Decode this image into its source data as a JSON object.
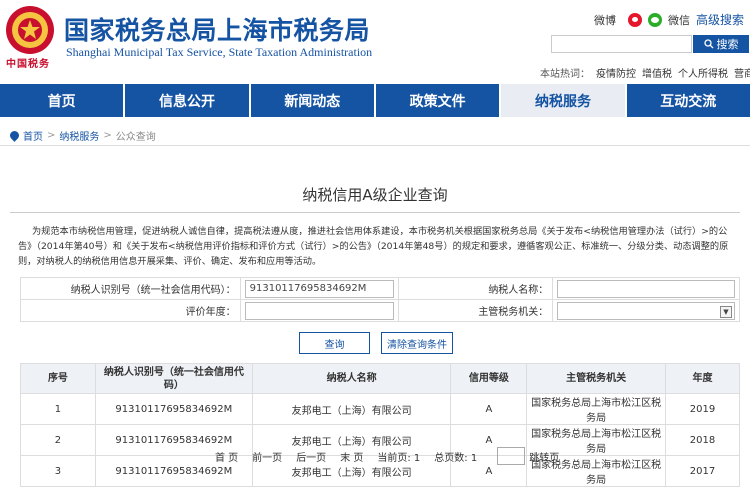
{
  "header": {
    "title": "国家税务总局上海市税务局",
    "subtitle": "Shanghai Municipal Tax Service, State Taxation Administration",
    "emblem_text": "中国税务",
    "weibo": "微博",
    "weixin": "微信",
    "advanced_search": "高级搜索",
    "search_placeholder": "",
    "search_button": "搜索",
    "hot_label": "本站热词：",
    "hot_words": [
      "疫情防控",
      "增值税",
      "个人所得税",
      "营商环境"
    ]
  },
  "nav": [
    "首页",
    "信息公开",
    "新闻动态",
    "政策文件",
    "纳税服务",
    "互动交流"
  ],
  "breadcrumb": [
    "首页",
    "纳税服务",
    "公众查询"
  ],
  "page": {
    "title": "纳税信用A级企业查询",
    "intro": "为规范本市纳税信用管理，促进纳税人诚信自律，提高税法遵从度，推进社会信用体系建设，本市税务机关根据国家税务总局《关于发布<纳税信用管理办法（试行）>的公告》（2014年第40号）和《关于发布<纳税信用评价指标和评价方式（试行）>的公告》（2014年第48号）的规定和要求，遵循客观公正、标准统一、分级分类、动态调整的原则，对纳税人的纳税信用信息开展采集、评价、确定、发布和应用等活动。"
  },
  "form": {
    "taxpayer_id_label": "纳税人识别号（统一社会信用代码）：",
    "taxpayer_id_value": "91310117695834692M",
    "taxpayer_name_label": "纳税人名称：",
    "taxpayer_name_value": "",
    "year_label": "评价年度：",
    "year_value": "",
    "authority_label": "主管税务机关：",
    "authority_value": "",
    "query_button": "查询",
    "clear_button": "清除查询条件"
  },
  "table": {
    "headers": [
      "序号",
      "纳税人识别号（统一社会信用代码）",
      "纳税人名称",
      "信用等级",
      "主管税务机关",
      "年度"
    ],
    "rows": [
      [
        "1",
        "91310117695834692M",
        "友邦电工（上海）有限公司",
        "A",
        "国家税务总局上海市松江区税务局",
        "2019"
      ],
      [
        "2",
        "91310117695834692M",
        "友邦电工（上海）有限公司",
        "A",
        "国家税务总局上海市松江区税务局",
        "2018"
      ],
      [
        "3",
        "91310117695834692M",
        "友邦电工（上海）有限公司",
        "A",
        "国家税务总局上海市松江区税务局",
        "2017"
      ]
    ]
  },
  "pager": {
    "first": "首 页",
    "prev": "前一页",
    "next": "后一页",
    "last": "末 页",
    "current": "当前页: 1",
    "total": "总页数: 1",
    "jump": "跳转页"
  }
}
